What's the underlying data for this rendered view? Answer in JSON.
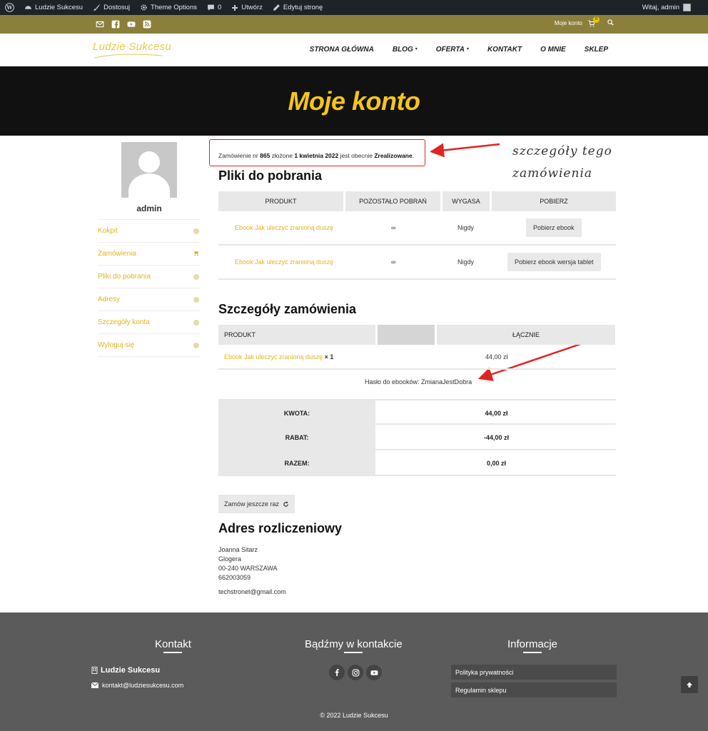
{
  "admin_bar": {
    "site_name": "Ludzie Sukcesu",
    "customize": "Dostosuj",
    "theme_options": "Theme Options",
    "comments_count": "0",
    "new": "Utwórz",
    "edit_page": "Edytuj stronę",
    "greeting": "Witaj, admin"
  },
  "top_bar": {
    "account_link": "Moje konto",
    "cart_count": "0"
  },
  "header": {
    "logo": "Ludzie Sukcesu",
    "nav": [
      {
        "label": "STRONA GŁÓWNA",
        "caret": ""
      },
      {
        "label": "BLOG",
        "caret": "▾"
      },
      {
        "label": "OFERTA",
        "caret": "▾"
      },
      {
        "label": "KONTAKT",
        "caret": ""
      },
      {
        "label": "O MNIE",
        "caret": ""
      },
      {
        "label": "SKLEP",
        "caret": ""
      }
    ]
  },
  "hero": {
    "title": "Moje konto"
  },
  "sidebar": {
    "username": "admin",
    "items": [
      "Kokpit",
      "Zamówienia",
      "Pliki do pobrania",
      "Adresy",
      "Szczegóły konta",
      "Wyloguj się"
    ]
  },
  "notice": {
    "prefix": "Zamówienie nr ",
    "order_number": "865",
    "middle": " złożone ",
    "date": "1 kwietnia 2022",
    "status_prefix": " jest obecnie ",
    "status": "Zrealizowane",
    "suffix": "."
  },
  "downloads": {
    "heading": "Pliki do pobrania",
    "columns": [
      "PRODUKT",
      "POZOSTAŁO POBRAŃ",
      "WYGASA",
      "POBIERZ"
    ],
    "rows": [
      {
        "product": "Ebook Jak uleczyć zranioną duszę",
        "remaining": "∞",
        "expires": "Nigdy",
        "button": "Pobierz ebook"
      },
      {
        "product": "Ebook Jak uleczyć zranioną duszę",
        "remaining": "∞",
        "expires": "Nigdy",
        "button": "Pobierz ebook wersja tablet"
      }
    ]
  },
  "order_details": {
    "heading": "Szczegóły zamówienia",
    "columns": [
      "PRODUKT",
      "ŁĄCZNIE"
    ],
    "item": {
      "product": "Ebook Jak uleczyć zranioną duszę",
      "qty": "× 1",
      "total": "44,00 zł"
    },
    "note": "Hasło do ebooków: ZmianaJestDobra",
    "totals": [
      {
        "label": "KWOTA:",
        "value": "44,00 zł"
      },
      {
        "label": "RABAT:",
        "value": "-44,00 zł"
      },
      {
        "label": "RAZEM:",
        "value": "0,00 zł"
      }
    ],
    "reorder_button": "Zamów jeszcze raz"
  },
  "billing": {
    "heading": "Adres rozliczeniowy",
    "lines": [
      "Joanna Sitarz",
      "Glogera",
      "00-240 WARSZAWA",
      "662003059"
    ],
    "email": "techstronet@gmail.com"
  },
  "annotation": {
    "line1": "szczegóły tego",
    "line2": "zamówienia"
  },
  "footer": {
    "contact_title": "Kontakt",
    "social_title": "Bądźmy w kontakcie",
    "info_title": "Informacje",
    "brand": "Ludzie Sukcesu",
    "email": "kontakt@ludziesukcesu.com",
    "links": [
      "Polityka prywatności",
      "Regulamin sklepu"
    ],
    "copyright": "© 2022 Ludzie Sukcesu"
  },
  "colors": {
    "accent": "#e4b31c",
    "topbar": "#8c7f3c",
    "hero_bg": "#111111",
    "hero_title": "#f5c518",
    "footer_bg": "#5b5b5b",
    "annotation_red": "#e02424"
  }
}
